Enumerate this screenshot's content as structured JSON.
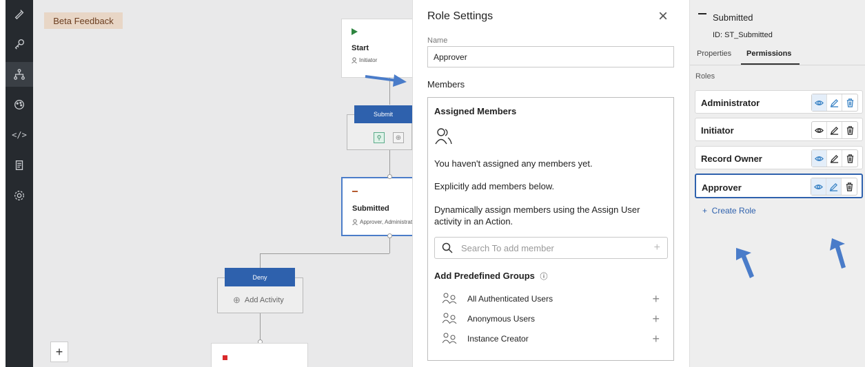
{
  "left_nav": {
    "items": [
      {
        "name": "design-icon",
        "label": ""
      },
      {
        "name": "key-icon",
        "label": ""
      },
      {
        "name": "workflow-icon",
        "label": ""
      },
      {
        "name": "palette-icon",
        "label": ""
      },
      {
        "name": "code-icon",
        "label": "</>"
      },
      {
        "name": "list-icon",
        "label": ""
      },
      {
        "name": "settings-icon",
        "label": ""
      }
    ]
  },
  "canvas": {
    "beta_feedback": "Beta Feedback",
    "start": {
      "title": "Start",
      "role": "Initiator"
    },
    "submit": {
      "label": "Submit"
    },
    "submitted": {
      "title": "Submitted",
      "roles": "Approver, Administrato"
    },
    "deny": {
      "label": "Deny",
      "add_activity": "Add Activity"
    },
    "zoom_in": "+"
  },
  "role_settings": {
    "title": "Role Settings",
    "close": "×",
    "name_label": "Name",
    "name_value": "Approver",
    "members_label": "Members",
    "assigned": {
      "title": "Assigned Members",
      "empty": "You haven't assigned any members yet.",
      "explicit": "Explicitly add members below.",
      "dynamic": "Dynamically assign members using the Assign User activity in an Action.",
      "search_placeholder": "Search To add member",
      "search_plus": "+"
    },
    "predefined": {
      "title": "Add Predefined Groups",
      "info": "ⓘ",
      "groups": [
        {
          "label": "All Authenticated Users",
          "action": "+"
        },
        {
          "label": "Anonymous Users",
          "action": "+"
        },
        {
          "label": "Instance Creator",
          "action": "+"
        }
      ]
    }
  },
  "right_panel": {
    "state_name": "Submitted",
    "state_id": "ID: ST_Submitted",
    "tabs": [
      {
        "label": "Properties",
        "active": false
      },
      {
        "label": "Permissions",
        "active": true
      }
    ],
    "roles_label": "Roles",
    "roles": [
      {
        "name": "Administrator",
        "selected": false,
        "icons": "blue"
      },
      {
        "name": "Initiator",
        "selected": false,
        "icons": "dark"
      },
      {
        "name": "Record Owner",
        "selected": false,
        "icons": "mixed"
      },
      {
        "name": "Approver",
        "selected": true,
        "icons": "mixed"
      }
    ],
    "create_role": "+  Create Role"
  },
  "colors": {
    "accent": "#2e61ad",
    "nav_bg": "#262a2f",
    "canvas_bg": "#e9e9ea",
    "beta_bg": "#e8d6c6",
    "arrow": "#4a7cc9"
  }
}
